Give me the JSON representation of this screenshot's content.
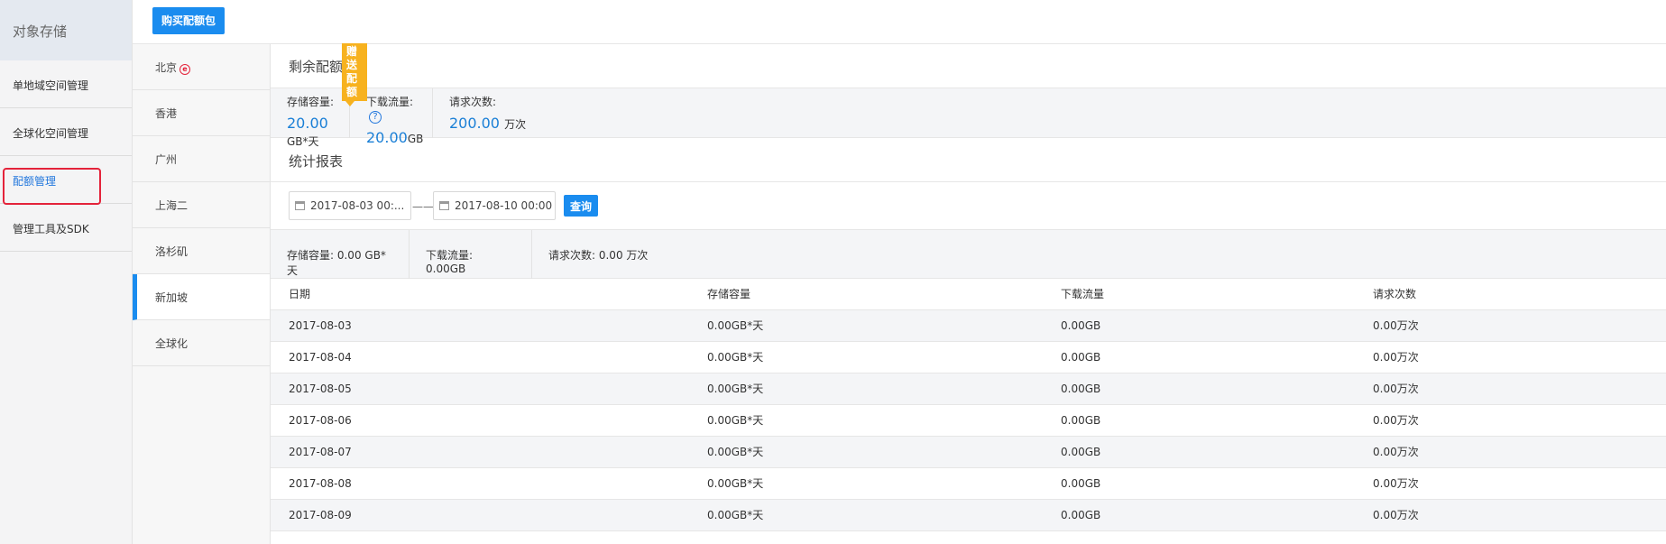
{
  "leftnav": {
    "title": "对象存储",
    "items": [
      {
        "label": "单地域空间管理"
      },
      {
        "label": "全球化空间管理"
      },
      {
        "label": "配额管理"
      },
      {
        "label": "管理工具及SDK"
      }
    ]
  },
  "toolbar": {
    "buy_label": "购买配额包"
  },
  "regions": {
    "items": [
      "北京",
      "香港",
      "广州",
      "上海二",
      "洛杉矶",
      "新加坡",
      "全球化"
    ],
    "badge": "e",
    "active_index": 5
  },
  "quota": {
    "title": "剩余配额:",
    "gift_tag": "赠送配额",
    "help": "?",
    "stats": [
      {
        "label": "存储容量:",
        "value": "20.00",
        "unit": "GB*天"
      },
      {
        "label": "下载流量:",
        "value": "20.00",
        "unit": "GB"
      },
      {
        "label": "请求次数:",
        "value": "200.00",
        "unit": "万次"
      }
    ]
  },
  "report": {
    "title": "统计报表",
    "start_date": "2017-08-03 00:...",
    "separator": "——",
    "end_date": "2017-08-10 00:00",
    "query_label": "查询",
    "summary": [
      "存储容量: 0.00 GB*天",
      "下载流量: 0.00GB",
      "请求次数: 0.00 万次"
    ]
  },
  "table": {
    "headers": [
      "日期",
      "存储容量",
      "下载流量",
      "请求次数"
    ],
    "rows": [
      [
        "2017-08-03",
        "0.00GB*天",
        "0.00GB",
        "0.00万次"
      ],
      [
        "2017-08-04",
        "0.00GB*天",
        "0.00GB",
        "0.00万次"
      ],
      [
        "2017-08-05",
        "0.00GB*天",
        "0.00GB",
        "0.00万次"
      ],
      [
        "2017-08-06",
        "0.00GB*天",
        "0.00GB",
        "0.00万次"
      ],
      [
        "2017-08-07",
        "0.00GB*天",
        "0.00GB",
        "0.00万次"
      ],
      [
        "2017-08-08",
        "0.00GB*天",
        "0.00GB",
        "0.00万次"
      ],
      [
        "2017-08-09",
        "0.00GB*天",
        "0.00GB",
        "0.00万次"
      ]
    ]
  }
}
